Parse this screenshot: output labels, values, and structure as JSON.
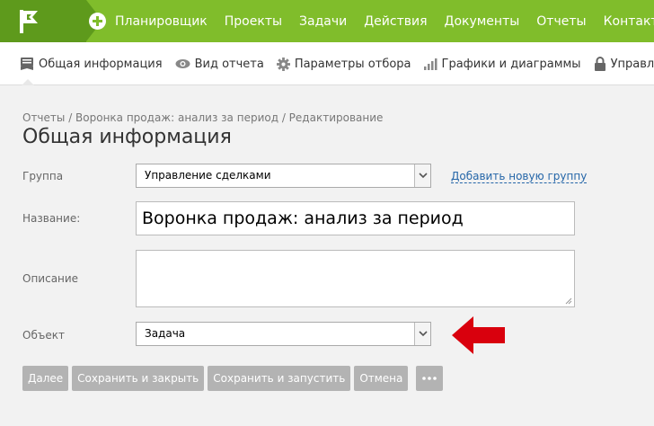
{
  "top_nav": {
    "items": [
      "Планировщик",
      "Проекты",
      "Задачи",
      "Действия",
      "Документы",
      "Отчеты",
      "Контакты"
    ],
    "logo_icon": "flag-logo-icon",
    "add_icon": "plus-circle-icon"
  },
  "sub_nav": {
    "items": [
      {
        "icon": "report-list-icon",
        "label": "Общая информация"
      },
      {
        "icon": "eye-icon",
        "label": "Вид отчета"
      },
      {
        "icon": "gear-icon",
        "label": "Параметры отбора"
      },
      {
        "icon": "bar-chart-icon",
        "label": "Графики и диаграммы"
      },
      {
        "icon": "lock-icon",
        "label": "Управлен"
      }
    ]
  },
  "breadcrumb": "Отчеты / Воронка продаж: анализ за период / Редактирование",
  "page_title": "Общая информация",
  "form": {
    "group_label": "Группа",
    "group_value": "Управление сделками",
    "add_group_link": "Добавить новую группу",
    "name_label": "Название:",
    "name_value": "Воронка продаж: анализ за период",
    "description_label": "Описание",
    "description_value": "",
    "object_label": "Объект",
    "object_value": "Задача"
  },
  "buttons": {
    "next": "Далее",
    "save_close": "Сохранить и закрыть",
    "save_run": "Сохранить и запустить",
    "cancel": "Отмена",
    "more_icon": "ellipsis-icon"
  },
  "colors": {
    "top_nav": "#80bd2b",
    "logo_block": "#5e9a1c",
    "button_gray": "#b3b3b3",
    "link": "#2566a8",
    "annotation_arrow": "#d9000d"
  }
}
